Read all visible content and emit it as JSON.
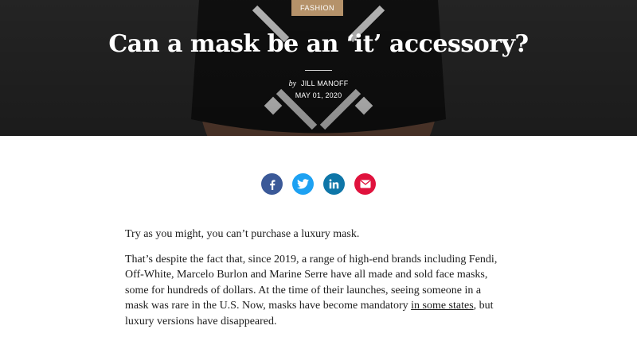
{
  "header": {
    "category": "FASHION",
    "title": "Can a mask be an ‘it’ accessory?",
    "by_label": "by",
    "author": "JILL MANOFF",
    "date": "MAY 01, 2020"
  },
  "share": [
    {
      "name": "facebook",
      "icon": "facebook-icon",
      "color": "#3b5998"
    },
    {
      "name": "twitter",
      "icon": "twitter-icon",
      "color": "#1da1f2"
    },
    {
      "name": "linkedin",
      "icon": "linkedin-icon",
      "color": "#0e76a8"
    },
    {
      "name": "email",
      "icon": "email-icon",
      "color": "#e0123d"
    }
  ],
  "article": {
    "p1": "Try as you might, you can’t purchase a luxury mask.",
    "p2_before": "That’s despite the fact that, since 2019, a range of high-end brands including Fendi, Off-White, Marcelo Burlon and Marine Serre have all made and sold face masks, some for hundreds of dollars. At the time of their launches, seeing someone in a mask was rare in the U.S. Now, masks have become mandatory ",
    "p2_link": "in some states",
    "p2_after": ", but luxury versions have disappeared."
  }
}
